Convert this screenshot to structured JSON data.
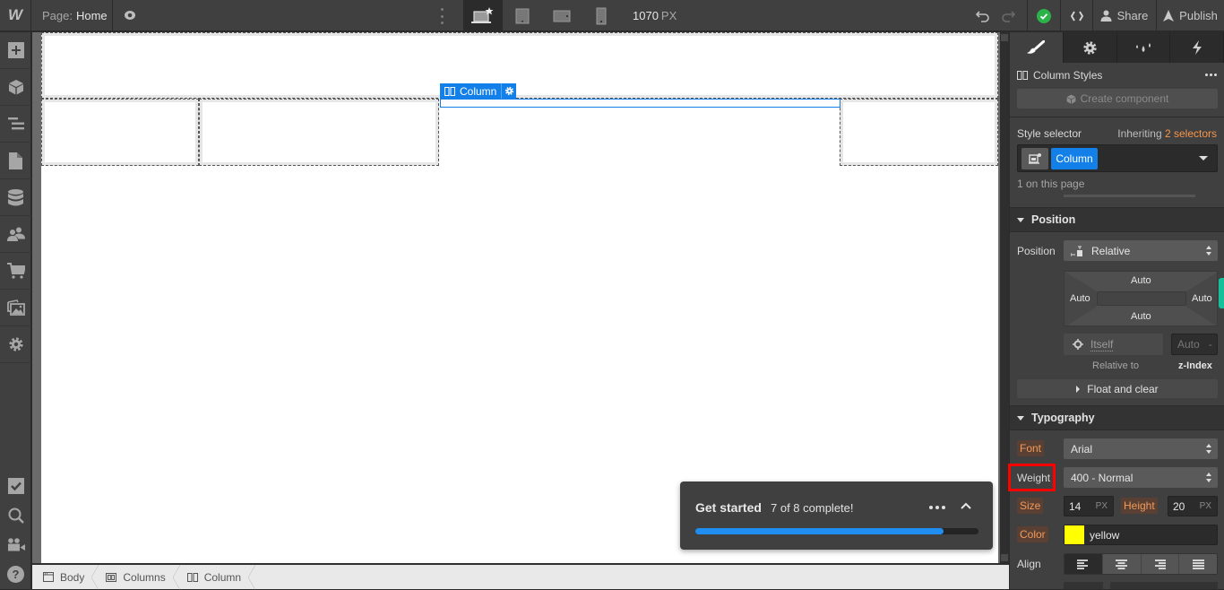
{
  "topbar": {
    "logo": "W",
    "page_prefix": "Page:",
    "page_name": "Home",
    "canvas_width": "1070",
    "canvas_unit": "PX",
    "share_label": "Share",
    "publish_label": "Publish",
    "devices": [
      "desktop-base",
      "tablet",
      "mobile-landscape",
      "mobile-portrait"
    ],
    "active_device": "desktop-base"
  },
  "leftbar": {
    "items": [
      "add-panel",
      "components",
      "navigator",
      "pages",
      "cms",
      "users",
      "ecommerce",
      "assets",
      "settings"
    ],
    "bottom_items": [
      "audit",
      "search",
      "video-tutorials",
      "help"
    ]
  },
  "canvas": {
    "selected_element_label": "Column"
  },
  "breadcrumb": [
    {
      "label": "Body",
      "icon": "body-icon"
    },
    {
      "label": "Columns",
      "icon": "columns-icon"
    },
    {
      "label": "Column",
      "icon": "column-icon"
    }
  ],
  "get_started": {
    "title": "Get started",
    "progress_text": "7 of 8 complete!",
    "completed": 7,
    "total": 8,
    "progress_fraction": 0.875
  },
  "style_panel": {
    "tabs": [
      "style",
      "settings",
      "interactions-drops",
      "interactions"
    ],
    "active_tab": "style",
    "header": "Column Styles",
    "create_component": "Create component",
    "style_selector_label": "Style selector",
    "inheriting_prefix": "Inheriting",
    "inheriting_count": "2 selectors",
    "selector_tag": "Column",
    "on_page": "1 on this page",
    "position": {
      "section_title": "Position",
      "label": "Position",
      "value": "Relative",
      "top": "Auto",
      "left": "Auto",
      "right": "Auto",
      "bottom": "Auto",
      "relative_to_value": "Itself",
      "relative_to_label": "Relative to",
      "zindex_value": "Auto",
      "zindex_dash": "-",
      "zindex_label": "z-Index",
      "float_clear": "Float and clear"
    },
    "typography": {
      "section_title": "Typography",
      "font_label": "Font",
      "font_value": "Arial",
      "weight_label": "Weight",
      "weight_value": "400 - Normal",
      "size_label": "Size",
      "size_value": "14",
      "size_unit": "PX",
      "height_label": "Height",
      "height_value": "20",
      "height_unit": "PX",
      "color_label": "Color",
      "color_value": "yellow",
      "color_hex": "#ffff00",
      "align_label": "Align",
      "align_options": [
        "left",
        "center",
        "right",
        "justify"
      ],
      "align_active": "left"
    }
  },
  "colors": {
    "accent_blue": "#1280e8",
    "publish_ok_green": "#2bb34a",
    "inherit_orange": "#f7954b",
    "highlight_red": "#ff0000"
  }
}
